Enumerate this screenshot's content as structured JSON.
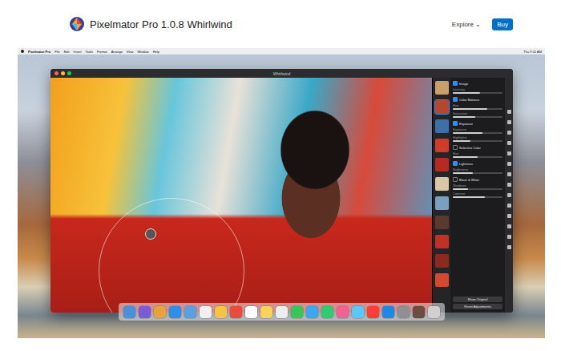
{
  "page": {
    "title": "Pixelmator Pro 1.0.8 Whirlwind",
    "nav": [
      {
        "label": "Explore ⌄"
      }
    ],
    "buy": "Buy"
  },
  "menubar": {
    "app": "Pixelmator Pro",
    "items": [
      "File",
      "Edit",
      "Insert",
      "Tools",
      "Format",
      "Arrange",
      "View",
      "Window",
      "Help"
    ],
    "clock": "Thu 9:41 AM"
  },
  "window": {
    "title": "Whirlwind"
  },
  "layers": [
    {
      "selected": false,
      "color": "#c9a06a"
    },
    {
      "selected": true,
      "color": "#b8452e"
    },
    {
      "selected": false,
      "color": "#3d6fa8"
    },
    {
      "selected": false,
      "color": "#d23a2a"
    },
    {
      "selected": false,
      "color": "#b72a22"
    },
    {
      "selected": false,
      "color": "#d9c7a8"
    },
    {
      "selected": false,
      "color": "#7aa0c0"
    },
    {
      "selected": false,
      "color": "#5a3a2e"
    },
    {
      "selected": false,
      "color": "#c23224"
    },
    {
      "selected": false,
      "color": "#8c2a1e"
    },
    {
      "selected": false,
      "color": "#d24a30"
    }
  ],
  "adjustments": [
    {
      "name": "Image",
      "on": true,
      "sliders": [
        {
          "label": "Intensity",
          "level": 0.55
        }
      ]
    },
    {
      "name": "Color Balance",
      "on": true,
      "sliders": [
        {
          "label": "Hue",
          "level": 0.7
        },
        {
          "label": "Saturation",
          "level": 0.45
        }
      ]
    },
    {
      "name": "Exposure",
      "on": true,
      "sliders": [
        {
          "label": "Exposure",
          "level": 0.6
        },
        {
          "label": "Highlights",
          "level": 0.35
        }
      ]
    },
    {
      "name": "Selective Color",
      "on": false,
      "sliders": [
        {
          "label": "Hue",
          "level": 0.5
        }
      ]
    },
    {
      "name": "Lightness",
      "on": true,
      "sliders": [
        {
          "label": "Brightness",
          "level": 0.4
        }
      ]
    },
    {
      "name": "Black & White",
      "on": false,
      "sliders": [
        {
          "label": "Shadows",
          "level": 0.3
        },
        {
          "label": "Contrast",
          "level": 0.65
        }
      ]
    }
  ],
  "buttons": [
    "Show Original",
    "Reset Adjustments"
  ],
  "dock": [
    {
      "color": "#4a90d9"
    },
    {
      "color": "#7b5cd6"
    },
    {
      "color": "#e8a23a"
    },
    {
      "color": "#2f8fe8"
    },
    {
      "color": "#5aa0e0"
    },
    {
      "color": "#f0f0f0"
    },
    {
      "color": "#f4c542"
    },
    {
      "color": "#e94b3c"
    },
    {
      "color": "#ffffff"
    },
    {
      "color": "#f6d35b"
    },
    {
      "color": "#ededed"
    },
    {
      "color": "#35c759"
    },
    {
      "color": "#3ba7f0"
    },
    {
      "color": "#2ecc71"
    },
    {
      "color": "#f06292"
    },
    {
      "color": "#5ac8fa"
    },
    {
      "color": "#fc3d39"
    },
    {
      "color": "#1e88e5"
    },
    {
      "color": "#8e8e93"
    },
    {
      "color": "#6d4c41"
    },
    {
      "color": "#d0d0d0"
    }
  ]
}
